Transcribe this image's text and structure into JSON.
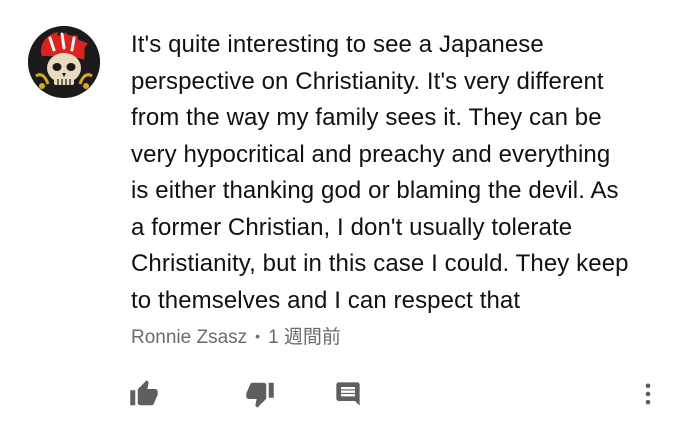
{
  "comment": {
    "author": "Ronnie Zsasz",
    "separator": "•",
    "timestamp": "1 週間前",
    "lines": [
      "It's quite interesting to see a Japanese",
      "perspective on Christianity. It's very different",
      "from the way my family sees it. They can be",
      "very hypocritical and preachy and everything",
      "is either thanking god or blaming the devil. As",
      "a former Christian, I don't usually tolerate",
      "Christianity, but in this case I could. They keep",
      "to themselves and I can respect that"
    ]
  },
  "actions": {
    "like_icon": "thumbs-up-icon",
    "dislike_icon": "thumbs-down-icon",
    "reply_icon": "comment-icon",
    "more_icon": "more-vertical-icon"
  },
  "colors": {
    "text": "#111111",
    "meta": "#6b6b6b",
    "icon": "#5f5f5f",
    "background": "#ffffff"
  }
}
